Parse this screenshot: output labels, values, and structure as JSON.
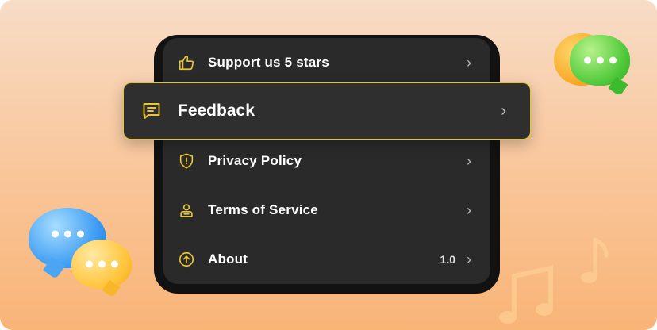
{
  "menu": {
    "support": {
      "label": "Support us 5 stars",
      "icon": "thumbs-up-icon"
    },
    "feedback": {
      "label": "Feedback",
      "icon": "message-icon"
    },
    "privacy": {
      "label": "Privacy Policy",
      "icon": "shield-icon"
    },
    "terms": {
      "label": "Terms of Service",
      "icon": "user-badge-icon"
    },
    "about": {
      "label": "About",
      "value": "1.0",
      "icon": "arrow-up-circle-icon"
    }
  },
  "colors": {
    "accent": "#e8c52f",
    "panel": "#2a2a2a",
    "background_top": "#f7dcc6",
    "background_bottom": "#f9b477"
  }
}
